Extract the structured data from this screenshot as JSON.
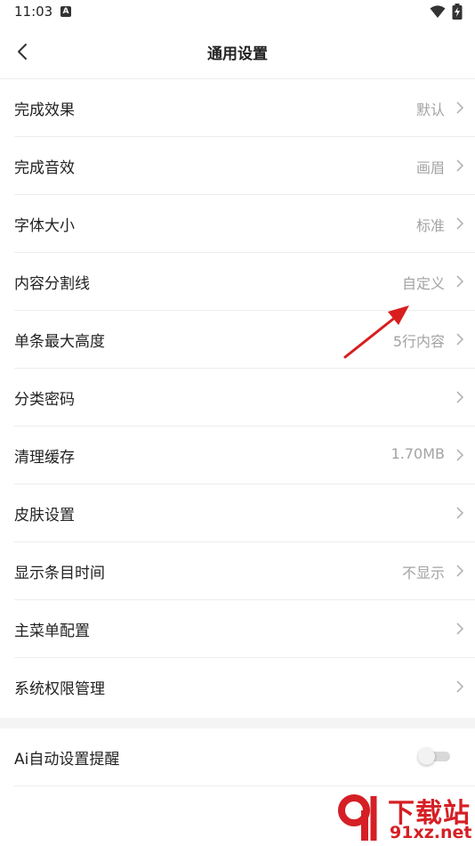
{
  "status": {
    "time": "11:03",
    "a_badge": "A"
  },
  "nav": {
    "title": "通用设置"
  },
  "items": [
    {
      "label": "完成效果",
      "value": "默认"
    },
    {
      "label": "完成音效",
      "value": "画眉"
    },
    {
      "label": "字体大小",
      "value": "标准"
    },
    {
      "label": "内容分割线",
      "value": "自定义"
    },
    {
      "label": "单条最大高度",
      "value": "5行内容"
    },
    {
      "label": "分类密码",
      "value": ""
    },
    {
      "label": "清理缓存",
      "value": "1.70MB"
    },
    {
      "label": "皮肤设置",
      "value": ""
    },
    {
      "label": "显示条目时间",
      "value": "不显示"
    },
    {
      "label": "主菜单配置",
      "value": ""
    },
    {
      "label": "系统权限管理",
      "value": ""
    }
  ],
  "toggle_item": {
    "label": "Ai自动设置提醒",
    "enabled": false
  },
  "watermark": {
    "title": "下载站",
    "url": "91xz.net"
  },
  "colors": {
    "value_text": "#a3a3a3",
    "watermark": "#d51f25",
    "arrow": "#d81e1e"
  },
  "icons": {
    "back": "chevron-left-icon",
    "row_arrow": "chevron-right-icon",
    "wifi": "wifi-icon",
    "battery": "battery-charging-icon"
  }
}
